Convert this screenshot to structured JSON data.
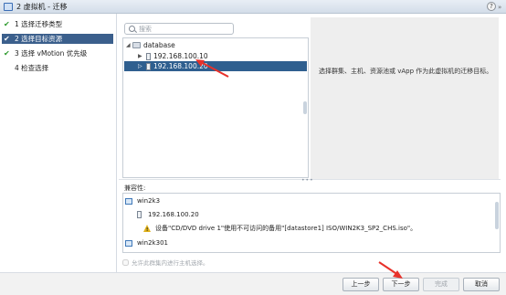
{
  "window": {
    "title": "2 虚拟机 - 迁移",
    "help_label": "?",
    "resize_glyph": "»"
  },
  "steps": [
    {
      "label": "1  选择迁移类型",
      "done": true
    },
    {
      "label": "2  选择目标资源",
      "done": true,
      "active": true
    },
    {
      "label": "3  选择 vMotion 优先级",
      "done": true
    },
    {
      "label": "4  检查选择",
      "done": false
    }
  ],
  "search": {
    "placeholder": "搜索",
    "value": ""
  },
  "tree": {
    "root": "database",
    "hosts": [
      {
        "label": "192.168.100.10",
        "selected": false
      },
      {
        "label": "192.168.100.20",
        "selected": true
      }
    ]
  },
  "info": {
    "description": "选择群集、主机、资源池或 vApp 作为此虚拟机的迁移目标。"
  },
  "compat": {
    "label": "兼容性:",
    "items": [
      {
        "vm": "win2k3"
      },
      {
        "host": "192.168.100.20"
      },
      {
        "warning": "设备\"CD/DVD drive 1\"使用不可访问的备用\"[datastore1] ISO/WIN2K3_SP2_CHS.iso\"。"
      },
      {
        "vm": "win2k301"
      }
    ]
  },
  "allow_selection": {
    "label": "允许此群集内进行主机选择。",
    "checked": false
  },
  "buttons": {
    "back": "上一步",
    "next": "下一步",
    "finish": "完成",
    "cancel": "取消"
  },
  "colors": {
    "selected_row": "#2f5f8f",
    "active_step": "#3b5f8c",
    "annotation_arrow": "#e8312a",
    "check": "#2d9a2d"
  }
}
